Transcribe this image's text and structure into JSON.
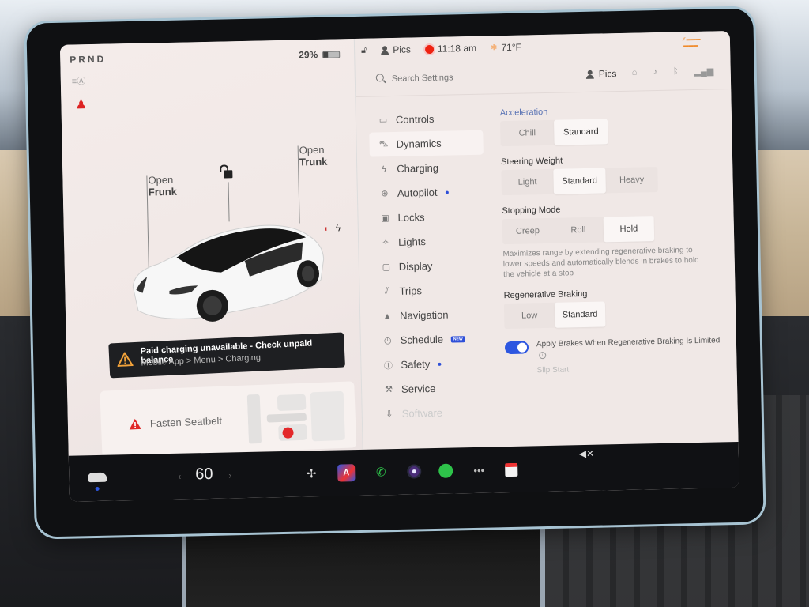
{
  "status": {
    "gear": "PRND",
    "battery_percent_label": "29%",
    "battery_level": 0.29,
    "profile_name": "Pics",
    "time": "11:18 am",
    "temperature": "71°F"
  },
  "vehicle": {
    "open_frunk": [
      "Open",
      "Frunk"
    ],
    "open_trunk": [
      "Open",
      "Trunk"
    ]
  },
  "alerts": {
    "charging_title": "Paid charging unavailable - Check unpaid balance",
    "charging_subtitle": "Mobile App > Menu > Charging",
    "seatbelt": "Fasten Seatbelt"
  },
  "settings": {
    "search_placeholder": "Search Settings",
    "profile_name": "Pics",
    "nav": [
      {
        "label": "Controls",
        "icon": "toggle-icon"
      },
      {
        "label": "Dynamics",
        "icon": "car-icon",
        "active": true
      },
      {
        "label": "Charging",
        "icon": "bolt-icon"
      },
      {
        "label": "Autopilot",
        "icon": "steering-wheel-icon",
        "dot": true
      },
      {
        "label": "Locks",
        "icon": "lock-icon"
      },
      {
        "label": "Lights",
        "icon": "light-icon"
      },
      {
        "label": "Display",
        "icon": "display-icon"
      },
      {
        "label": "Trips",
        "icon": "trips-icon"
      },
      {
        "label": "Navigation",
        "icon": "navigation-icon"
      },
      {
        "label": "Schedule",
        "icon": "schedule-icon",
        "badge": "NEW"
      },
      {
        "label": "Safety",
        "icon": "safety-icon",
        "dot": true
      },
      {
        "label": "Service",
        "icon": "wrench-icon"
      },
      {
        "label": "Software",
        "icon": "download-icon",
        "faded": true
      }
    ],
    "acceleration": {
      "title": "Acceleration",
      "options": [
        "Chill",
        "Standard"
      ],
      "selected": "Standard"
    },
    "steering_weight": {
      "title": "Steering Weight",
      "options": [
        "Light",
        "Standard",
        "Heavy"
      ],
      "selected": "Standard"
    },
    "stopping_mode": {
      "title": "Stopping Mode",
      "options": [
        "Creep",
        "Roll",
        "Hold"
      ],
      "selected": "Hold",
      "description": "Maximizes range by extending regenerative braking to lower speeds and automatically blends in brakes to hold the vehicle at a stop"
    },
    "regen_braking": {
      "title": "Regenerative Braking",
      "options": [
        "Low",
        "Standard"
      ],
      "selected": "Standard"
    },
    "apply_brakes_toggle": {
      "label": "Apply Brakes When Regenerative Braking Is Limited",
      "on": true
    },
    "partial_row": "Slip Start"
  },
  "dock": {
    "cabin_temp": "60",
    "left_chevron": "‹",
    "right_chevron": "›",
    "icons": [
      "fan-icon",
      "navigation-app-icon",
      "phone-icon",
      "camera-icon",
      "spotify-icon",
      "more-icon",
      "calendar-icon",
      "mute-icon"
    ]
  }
}
